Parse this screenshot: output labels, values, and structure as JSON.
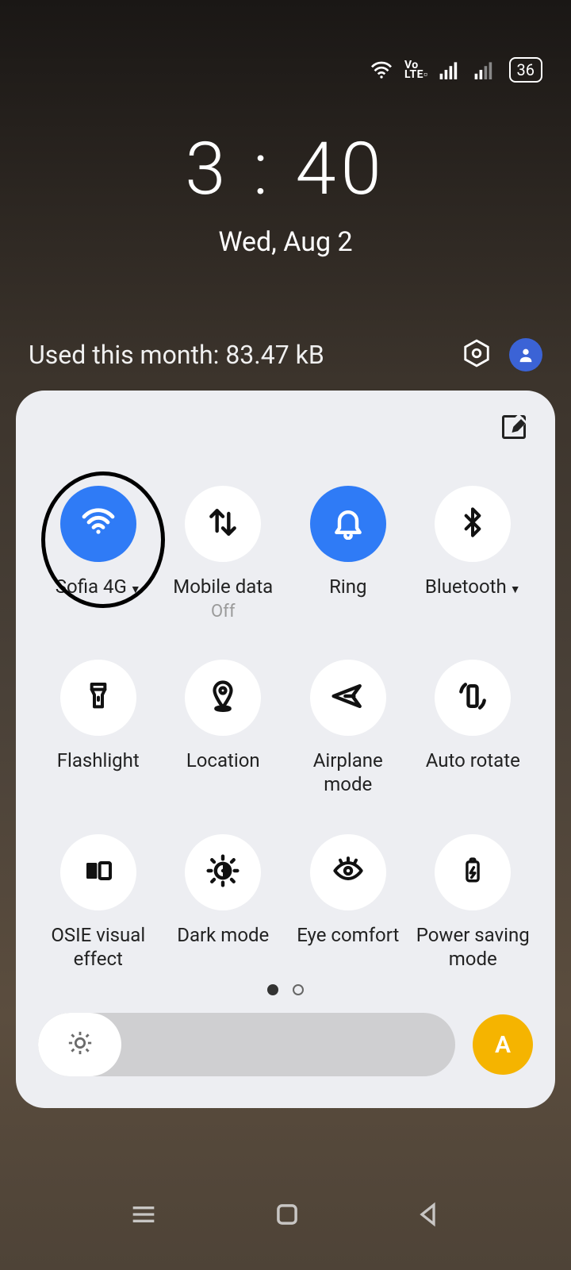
{
  "status": {
    "volte_top": "Vo",
    "volte_bot": "LTE▫",
    "battery": "36"
  },
  "clock": {
    "time": "3 : 40",
    "date": "Wed, Aug 2"
  },
  "usage": {
    "text": "Used this month: 83.47 kB"
  },
  "tiles": [
    {
      "label": "Sofia 4G",
      "sub": "",
      "active": true,
      "expand": true,
      "icon": "wifi"
    },
    {
      "label": "Mobile data",
      "sub": "Off",
      "active": false,
      "expand": false,
      "icon": "data"
    },
    {
      "label": "Ring",
      "sub": "",
      "active": true,
      "expand": false,
      "icon": "bell"
    },
    {
      "label": "Bluetooth",
      "sub": "",
      "active": false,
      "expand": true,
      "icon": "bluetooth"
    },
    {
      "label": "Flashlight",
      "sub": "",
      "active": false,
      "expand": false,
      "icon": "flashlight"
    },
    {
      "label": "Location",
      "sub": "",
      "active": false,
      "expand": false,
      "icon": "location"
    },
    {
      "label": "Airplane mode",
      "sub": "",
      "active": false,
      "expand": false,
      "icon": "airplane"
    },
    {
      "label": "Auto rotate",
      "sub": "",
      "active": false,
      "expand": false,
      "icon": "rotate"
    },
    {
      "label": "OSIE visual effect",
      "sub": "",
      "active": false,
      "expand": false,
      "icon": "osie"
    },
    {
      "label": "Dark mode",
      "sub": "",
      "active": false,
      "expand": false,
      "icon": "dark"
    },
    {
      "label": "Eye comfort",
      "sub": "",
      "active": false,
      "expand": false,
      "icon": "eye"
    },
    {
      "label": "Power saving mode",
      "sub": "",
      "active": false,
      "expand": false,
      "icon": "battery"
    }
  ],
  "brightness": {
    "auto_label": "A",
    "level_percent": 20
  },
  "page": {
    "current": 0,
    "total": 2
  }
}
